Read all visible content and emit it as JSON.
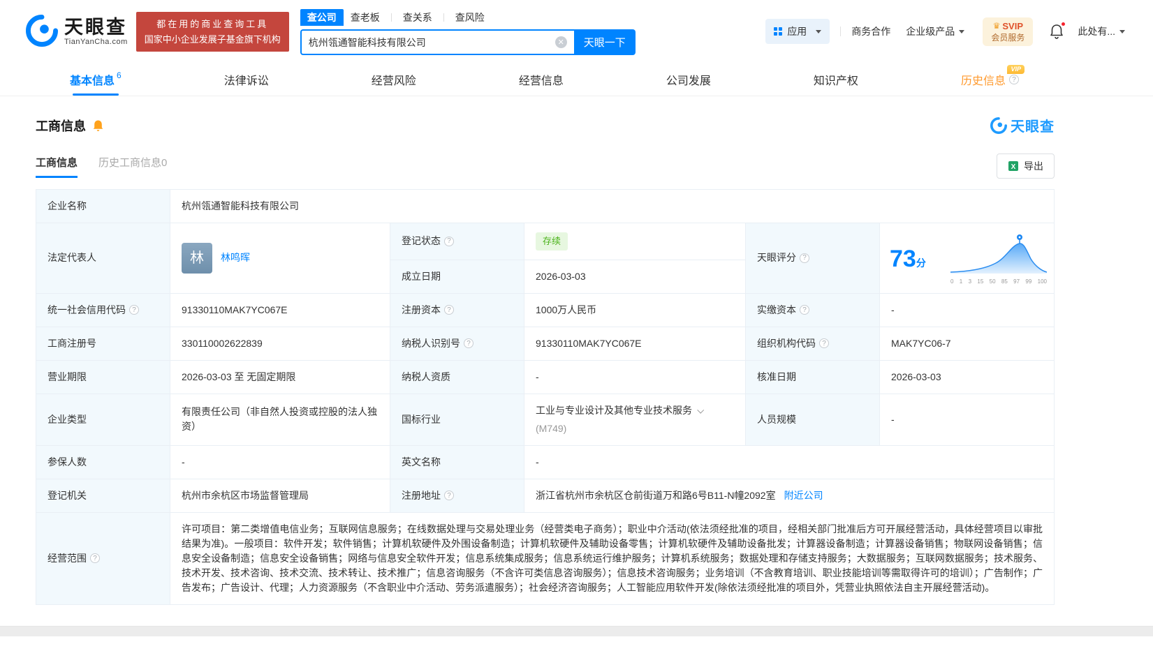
{
  "brand": {
    "name": "天眼查",
    "domain": "TianYanCha.com",
    "accent": "#0084ff"
  },
  "promo": {
    "line1": "都在用的商业查询工具",
    "line2": "国家中小企业发展子基金旗下机构",
    "bg": "#c4463d"
  },
  "search": {
    "tabs": [
      {
        "label": "查公司",
        "active": true
      },
      {
        "label": "查老板",
        "active": false
      },
      {
        "label": "查关系",
        "active": false
      },
      {
        "label": "查风险",
        "active": false
      }
    ],
    "value": "杭州瓴通智能科技有限公司",
    "button": "天眼一下"
  },
  "header_right": {
    "apps": "应用",
    "cooperation": "商务合作",
    "enterprise": "企业级产品",
    "svip_top": "SVIP",
    "svip_bottom": "会员服务",
    "user": "此处有..."
  },
  "nav_tabs": [
    {
      "label": "基本信息",
      "badge": "6"
    },
    {
      "label": "法律诉讼"
    },
    {
      "label": "经营风险"
    },
    {
      "label": "经营信息"
    },
    {
      "label": "公司发展"
    },
    {
      "label": "知识产权"
    },
    {
      "label": "历史信息",
      "vip": "VIP"
    }
  ],
  "section": {
    "title": "工商信息",
    "watermark": "天眼查",
    "subtab_active": "工商信息",
    "subtab_history": "历史工商信息",
    "subtab_history_count": "0",
    "export": "导出"
  },
  "info": {
    "company_name": {
      "label": "企业名称",
      "value": "杭州瓴通智能科技有限公司"
    },
    "legal_rep": {
      "label": "法定代表人",
      "avatar": "林",
      "name": "林鸣晖"
    },
    "reg_status": {
      "label": "登记状态",
      "value": "存续"
    },
    "establish_date": {
      "label": "成立日期",
      "value": "2026-03-03"
    },
    "score": {
      "label": "天眼评分",
      "value": "73",
      "unit": "分",
      "ticks": [
        "0",
        "1",
        "3",
        "15",
        "50",
        "85",
        "97",
        "99",
        "100"
      ]
    },
    "credit_code": {
      "label": "统一社会信用代码",
      "value": "91330110MAK7YC067E"
    },
    "reg_capital": {
      "label": "注册资本",
      "value": "1000万人民币"
    },
    "paid_capital": {
      "label": "实缴资本",
      "value": "-"
    },
    "reg_number": {
      "label": "工商注册号",
      "value": "330110002622839"
    },
    "taxpayer_id": {
      "label": "纳税人识别号",
      "value": "91330110MAK7YC067E"
    },
    "org_code": {
      "label": "组织机构代码",
      "value": "MAK7YC06-7"
    },
    "business_term": {
      "label": "营业期限",
      "value": "2026-03-03 至 无固定期限"
    },
    "taxpayer_quality": {
      "label": "纳税人资质",
      "value": "-"
    },
    "approval_date": {
      "label": "核准日期",
      "value": "2026-03-03"
    },
    "company_type": {
      "label": "企业类型",
      "value": "有限责任公司（非自然人投资或控股的法人独资）"
    },
    "industry": {
      "label": "国标行业",
      "value": "工业与专业设计及其他专业技术服务",
      "code": "(M749)"
    },
    "staff_size": {
      "label": "人员规模",
      "value": "-"
    },
    "insured_count": {
      "label": "参保人数",
      "value": "-"
    },
    "english_name": {
      "label": "英文名称",
      "value": "-"
    },
    "reg_authority": {
      "label": "登记机关",
      "value": "杭州市余杭区市场监督管理局"
    },
    "reg_address": {
      "label": "注册地址",
      "value": "浙江省杭州市余杭区仓前街道万和路6号B11-N幢2092室",
      "link": "附近公司"
    },
    "business_scope": {
      "label": "经营范围",
      "value": "许可项目：第二类增值电信业务；互联网信息服务；在线数据处理与交易处理业务（经营类电子商务）；职业中介活动(依法须经批准的项目，经相关部门批准后方可开展经营活动，具体经营项目以审批结果为准)。一般项目：软件开发；软件销售；计算机软硬件及外围设备制造；计算机软硬件及辅助设备零售；计算机软硬件及辅助设备批发；计算器设备制造；计算器设备销售；物联网设备销售；信息安全设备制造；信息安全设备销售；网络与信息安全软件开发；信息系统集成服务；信息系统运行维护服务；计算机系统服务；数据处理和存储支持服务；大数据服务；互联网数据服务；技术服务、技术开发、技术咨询、技术交流、技术转让、技术推广；信息咨询服务（不含许可类信息咨询服务）；信息技术咨询服务；业务培训（不含教育培训、职业技能培训等需取得许可的培训）；广告制作；广告发布；广告设计、代理；人力资源服务（不含职业中介活动、劳务派遣服务）；社会经济咨询服务；人工智能应用软件开发(除依法须经批准的项目外，凭营业执照依法自主开展经营活动)。"
    }
  }
}
